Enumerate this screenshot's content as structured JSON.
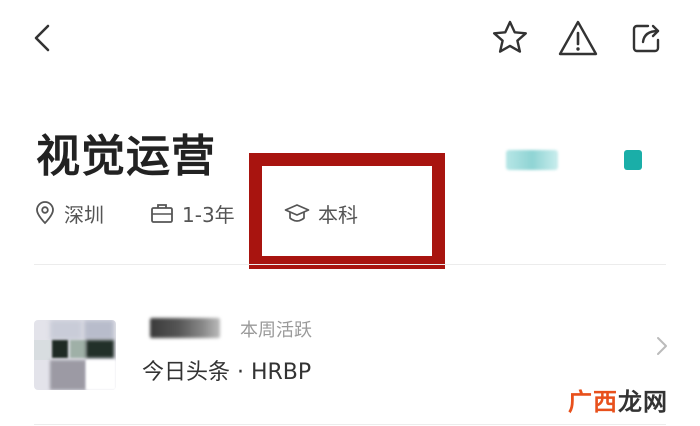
{
  "job": {
    "title": "视觉运营",
    "location": "深圳",
    "experience": "1-3年",
    "education": "本科"
  },
  "recruiter": {
    "active_status": "本周活跃",
    "company_role": "今日头条 · HRBP"
  },
  "watermark": {
    "part1": "广西",
    "part2": "龙网"
  },
  "icons": {
    "back": "chevron-left-icon",
    "favorite": "star-icon",
    "report": "warning-icon",
    "share": "share-icon",
    "location": "location-pin-icon",
    "experience": "briefcase-icon",
    "education": "graduation-cap-icon",
    "row_arrow": "chevron-right-icon"
  },
  "colors": {
    "highlight_box": "#a8140f",
    "salary_accent": "#1aaea8",
    "watermark_orange": "#e8501c"
  }
}
